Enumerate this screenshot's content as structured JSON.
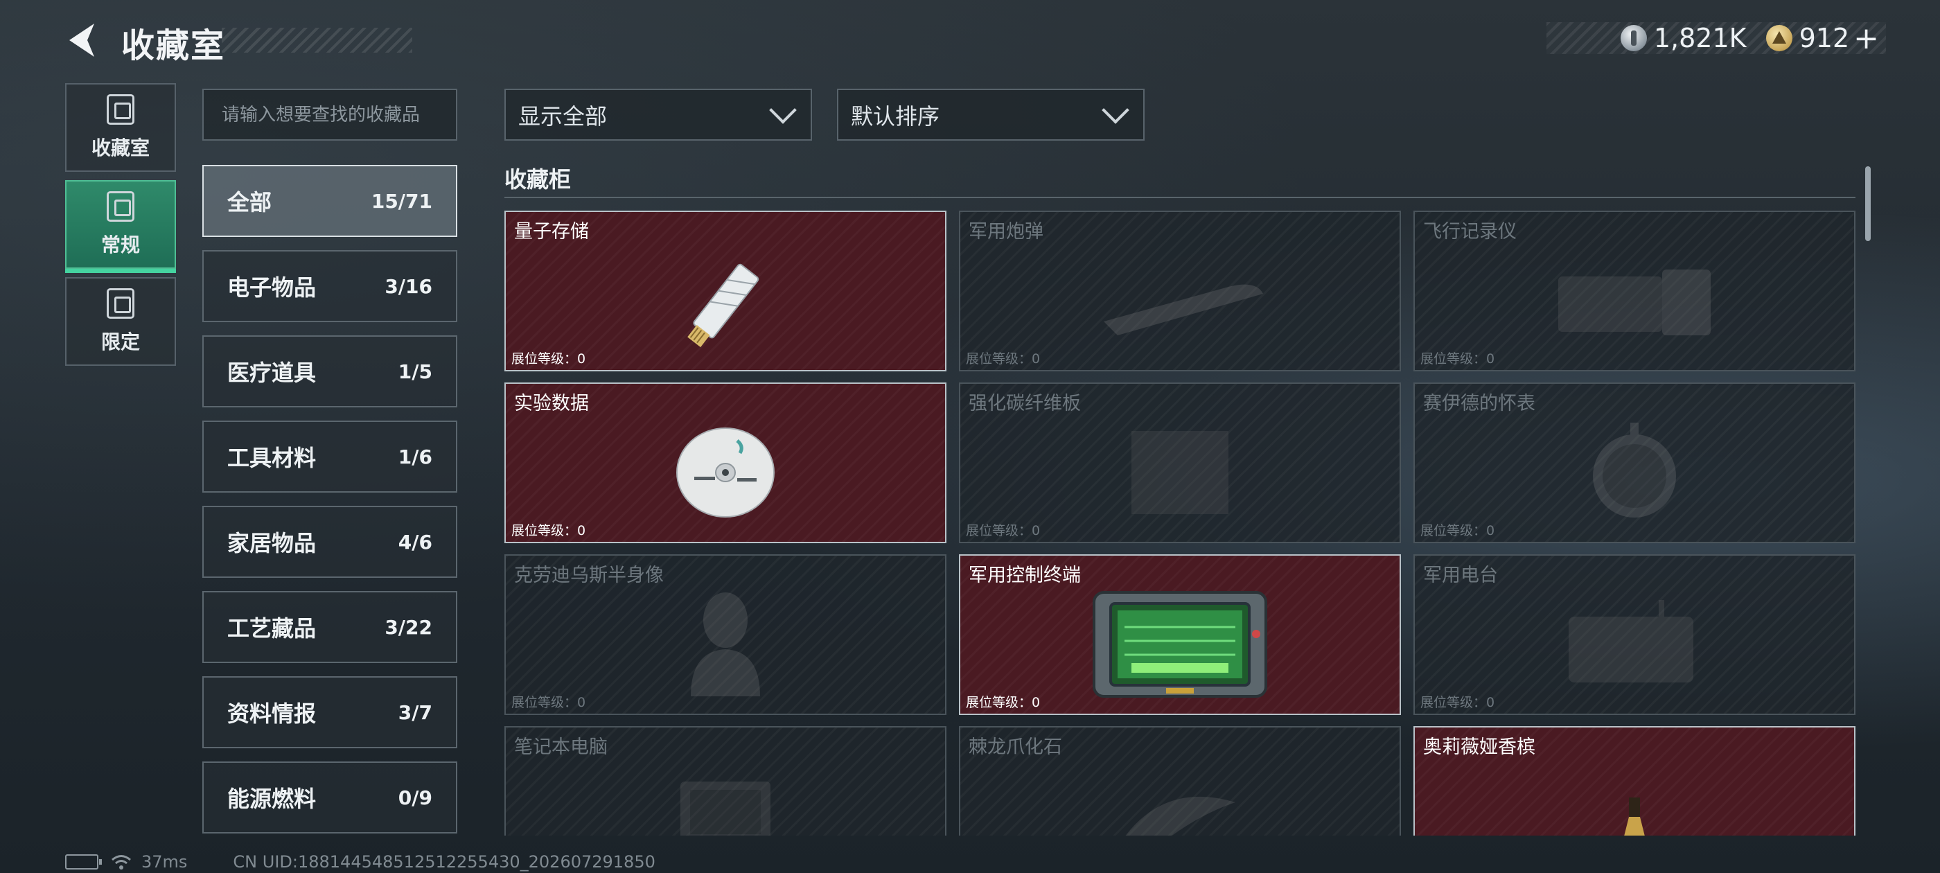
{
  "header": {
    "title": "收藏室",
    "currencies": [
      {
        "icon": "silver-coin-icon",
        "value": "1,821K"
      },
      {
        "icon": "gold-coin-icon",
        "value": "912"
      }
    ],
    "plus_label": "+"
  },
  "side_nav": [
    {
      "label": "收藏室",
      "icon": "collection-room-icon",
      "active": false
    },
    {
      "label": "常规",
      "icon": "regular-icon",
      "active": true
    },
    {
      "label": "限定",
      "icon": "limited-icon",
      "active": false
    }
  ],
  "search": {
    "placeholder": "请输入想要查找的收藏品",
    "value": ""
  },
  "filters": {
    "show": {
      "value": "显示全部"
    },
    "sort": {
      "value": "默认排序"
    }
  },
  "categories": [
    {
      "name": "全部",
      "count": "15/71",
      "active": true
    },
    {
      "name": "电子物品",
      "count": "3/16"
    },
    {
      "name": "医疗道具",
      "count": "1/5"
    },
    {
      "name": "工具材料",
      "count": "1/6"
    },
    {
      "name": "家居物品",
      "count": "4/6"
    },
    {
      "name": "工艺藏品",
      "count": "3/22"
    },
    {
      "name": "资料情报",
      "count": "3/7"
    },
    {
      "name": "能源燃料",
      "count": "0/9"
    }
  ],
  "cabinet": {
    "title": "收藏柜",
    "items": [
      {
        "name": "量子存储",
        "level": "展位等级：0",
        "owned": true
      },
      {
        "name": "军用炮弹",
        "level": "展位等级：0",
        "owned": false
      },
      {
        "name": "飞行记录仪",
        "level": "展位等级：0",
        "owned": false
      },
      {
        "name": "实验数据",
        "level": "展位等级：0",
        "owned": true
      },
      {
        "name": "强化碳纤维板",
        "level": "展位等级：0",
        "owned": false
      },
      {
        "name": "赛伊德的怀表",
        "level": "展位等级：0",
        "owned": false
      },
      {
        "name": "克劳迪乌斯半身像",
        "level": "展位等级：0",
        "owned": false
      },
      {
        "name": "军用控制终端",
        "level": "展位等级：0",
        "owned": true
      },
      {
        "name": "军用电台",
        "level": "展位等级：0",
        "owned": false
      },
      {
        "name": "笔记本电脑",
        "level": "",
        "owned": false
      },
      {
        "name": "棘龙爪化石",
        "level": "",
        "owned": false
      },
      {
        "name": "奥莉薇娅香槟",
        "level": "",
        "owned": true
      }
    ]
  },
  "status_bar": {
    "ping": "37ms",
    "uid": "CN UID:188144548512512255430_202607291850"
  }
}
